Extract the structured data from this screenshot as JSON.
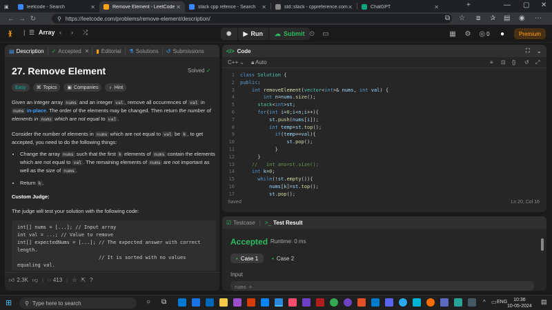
{
  "browser": {
    "tabs": [
      {
        "title": "leetcode - Search",
        "color": "#3a86ff"
      },
      {
        "title": "Remove Element - LeetCode",
        "color": "#ffa116",
        "active": true
      },
      {
        "title": "stack cpp refence - Search",
        "color": "#3a86ff"
      },
      {
        "title": "std::stack - cppreference.com",
        "color": "#888888"
      },
      {
        "title": "ChatGPT",
        "color": "#10a37f"
      }
    ],
    "url": "https://leetcode.com/problems/remove-element/description/"
  },
  "lc_nav": {
    "problem_list": "Array",
    "run_label": "Run",
    "submit_label": "Submit",
    "coin_count": "0",
    "premium_label": "Premium"
  },
  "description_panel": {
    "tabs": [
      "Description",
      "Accepted",
      "Editorial",
      "Solutions",
      "Submissions"
    ],
    "title": "27. Remove Element",
    "solved_label": "Solved",
    "chips": [
      "Easy",
      "Topics",
      "Companies",
      "Hint"
    ],
    "p1": {
      "t1": "Given an integer array ",
      "c1": "nums",
      "t2": " and an integer ",
      "c2": "val",
      "t3": ", remove all occurrences of ",
      "c3": "val",
      "t4": " in ",
      "c4": "nums",
      "t5": " ",
      "inplace": "in-place",
      "t6": ". The order of the elements may be changed. Then return ",
      "em1": "the number of elements in ",
      "c5": "nums",
      "em2": " which are not equal to ",
      "c6": "val",
      "t7": "."
    },
    "p2": {
      "t1": "Consider the number of elements in ",
      "c1": "nums",
      "t2": " which are not equal to ",
      "c2": "val",
      "t3": " be ",
      "c3": "k",
      "t4": ", to get accepted, you need to do the following things:"
    },
    "bullet1": {
      "t1": "Change the array ",
      "c1": "nums",
      "t2": " such that the first ",
      "c2": "k",
      "t3": " elements of ",
      "c3": "nums",
      "t4": " contain the elements which are not equal to ",
      "c4": "val",
      "t5": ". The remaining elements of ",
      "c5": "nums",
      "t6": " are not important as well as the size of ",
      "c6": "nums",
      "t7": "."
    },
    "bullet2": {
      "t1": "Return ",
      "c1": "k",
      "t2": "."
    },
    "custom_judge_title": "Custom Judge:",
    "judge_text": "The judge will test your solution with the following code:",
    "judge_code": "int[] nums = [...]; // Input array\nint val = ...; // Value to remove\nint[] expectedNums = [...]; // The expected answer with correct length.\n                            // It is sorted with no values equaling val.",
    "footer": {
      "likes": "2.3K",
      "comments": "413"
    }
  },
  "code_panel": {
    "title": "Code",
    "language": "C++",
    "auto_label": "Auto",
    "saved_label": "Saved",
    "cursor": "Ln 20, Col 16",
    "lines": [
      {
        "n": "1",
        "html": "<span class=\"kw\">class</span> <span class=\"ty\">Solution</span> {"
      },
      {
        "n": "2",
        "html": "<span class=\"kw\">public</span>:"
      },
      {
        "n": "3",
        "html": "    <span class=\"kw\">int</span> <span class=\"fn\">removeElement</span>(<span class=\"ty\">vector</span>&lt;<span class=\"kw\">int</span>&gt;&amp; <span class=\"vr\">nums</span>, <span class=\"kw\">int</span> <span class=\"vr\">val</span>) {"
      },
      {
        "n": "4",
        "html": "        <span class=\"kw\">int</span> <span class=\"vr\">n</span>=<span class=\"vr\">nums</span>.<span class=\"fn\">size</span>();"
      },
      {
        "n": "5",
        "html": "      <span class=\"ty\">stack</span>&lt;<span class=\"kw\">int</span>&gt;<span class=\"vr\">st</span>;"
      },
      {
        "n": "6",
        "html": "      <span class=\"kw\">for</span>(<span class=\"kw\">int</span> <span class=\"vr\">i</span>=<span class=\"nm\">0</span>;<span class=\"vr\">i</span>&lt;<span class=\"vr\">n</span>;<span class=\"vr\">i</span>++){"
      },
      {
        "n": "7",
        "html": "          <span class=\"vr\">st</span>.<span class=\"fn\">push</span>(<span class=\"vr\">nums</span>[<span class=\"vr\">i</span>]);"
      },
      {
        "n": "8",
        "html": "          <span class=\"kw\">int</span> <span class=\"vr\">temp</span>=<span class=\"vr\">st</span>.<span class=\"fn\">top</span>();"
      },
      {
        "n": "9",
        "html": "            <span class=\"kw\">if</span>(<span class=\"vr\">temp</span>==<span class=\"vr\">val</span>){"
      },
      {
        "n": "10",
        "html": "                <span class=\"vr\">st</span>.<span class=\"fn\">pop</span>();"
      },
      {
        "n": "11",
        "html": "            }"
      },
      {
        "n": "12",
        "html": "      }"
      },
      {
        "n": "13",
        "html": "    <span class=\"cm\">//   int ans=st.size();</span>"
      },
      {
        "n": "14",
        "html": "    <span class=\"kw\">int</span> <span class=\"vr\">k</span>=<span class=\"nm\">0</span>;"
      },
      {
        "n": "15",
        "html": "      <span class=\"kw\">while</span>(!<span class=\"vr\">st</span>.<span class=\"fn\">empty</span>()){"
      },
      {
        "n": "16",
        "html": "          <span class=\"vr\">nums</span>[<span class=\"vr\">k</span>]=<span class=\"vr\">st</span>.<span class=\"fn\">top</span>();"
      },
      {
        "n": "17",
        "html": "          <span class=\"vr\">st</span>.<span class=\"fn\">pop</span>();"
      }
    ]
  },
  "test_panel": {
    "testcase_tab": "Testcase",
    "result_tab": "Test Result",
    "accepted": "Accepted",
    "runtime": "Runtime: 0 ms",
    "case1": "Case 1",
    "case2": "Case 2",
    "input_label": "Input",
    "input_preview": "nums ="
  },
  "taskbar": {
    "search_placeholder": "Type here to search",
    "lang": "ENG",
    "time": "10:36",
    "date": "10-05-2024"
  },
  "colors": {
    "accent": "#ffa116",
    "accepted": "#2cbb5d",
    "link": "#3c9cff"
  }
}
